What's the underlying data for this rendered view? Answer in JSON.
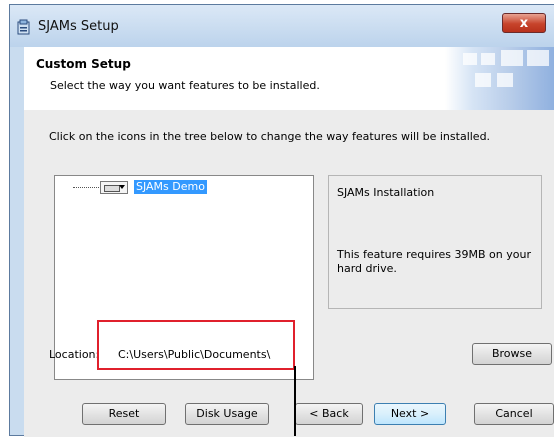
{
  "window": {
    "title": "SJAMs Setup",
    "close_glyph": "x"
  },
  "header": {
    "title": "Custom Setup",
    "subtitle": "Select the way you want features to be installed."
  },
  "main": {
    "instructions": "Click on the icons in the tree below to change the way features will be installed.",
    "tree": {
      "items": [
        {
          "label": "SJAMs Demo",
          "icon": "drive-icon",
          "selected": true
        }
      ]
    },
    "description": {
      "title": "SJAMs Installation",
      "requirement": "This feature requires 39MB on your hard drive."
    },
    "location": {
      "label": "Location:",
      "path": "C:\\Users\\Public\\Documents\\"
    }
  },
  "buttons": {
    "browse": "Browse",
    "reset": "Reset",
    "disk_usage": "Disk Usage",
    "back": "< Back",
    "next": "Next >",
    "cancel": "Cancel"
  },
  "colors": {
    "highlight_box": "#e0202c",
    "tree_selection": "#3399ff",
    "close_button": "#c7432b"
  }
}
